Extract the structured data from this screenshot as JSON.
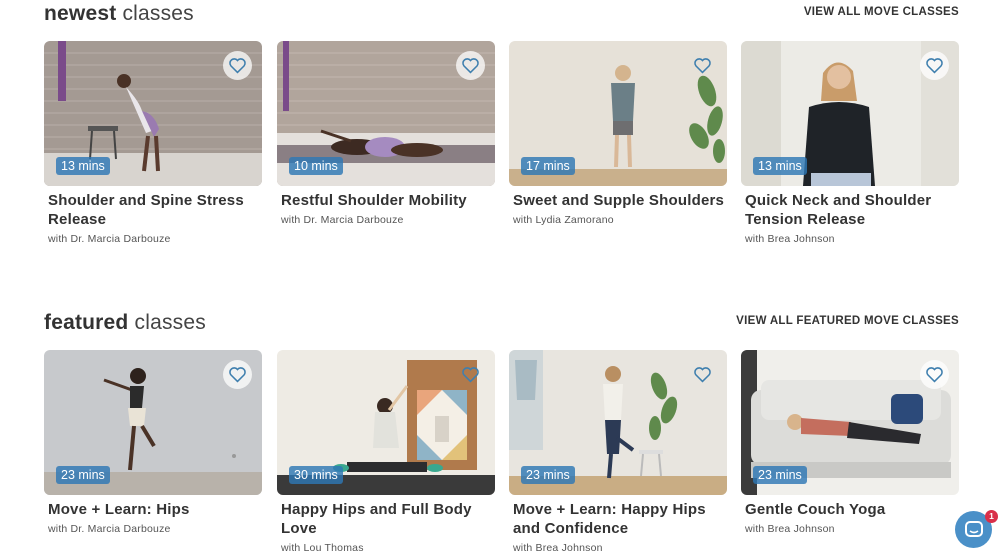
{
  "sections": {
    "newest": {
      "title_bold": "newest",
      "title_rest": "classes",
      "view_all": "VIEW ALL MOVE CLASSES",
      "cards": [
        {
          "duration": "13 mins",
          "title": "Shoulder and Spine Stress Release",
          "with": "with",
          "author": "Dr. Marcia Darbouze"
        },
        {
          "duration": "10 mins",
          "title": "Restful Shoulder Mobility",
          "with": "with",
          "author": "Dr. Marcia Darbouze"
        },
        {
          "duration": "17 mins",
          "title": "Sweet and Supple Shoulders",
          "with": "with",
          "author": "Lydia Zamorano"
        },
        {
          "duration": "13 mins",
          "title": "Quick Neck and Shoulder Tension Release",
          "with": "with",
          "author": "Brea Johnson"
        }
      ]
    },
    "featured": {
      "title_bold": "featured",
      "title_rest": "classes",
      "view_all": "VIEW ALL FEATURED MOVE CLASSES",
      "cards": [
        {
          "duration": "23 mins",
          "title": "Move + Learn: Hips",
          "with": "with",
          "author": "Dr. Marcia Darbouze"
        },
        {
          "duration": "30 mins",
          "title": "Happy Hips and Full Body Love",
          "with": "with",
          "author": "Lou Thomas"
        },
        {
          "duration": "23 mins",
          "title": "Move + Learn: Happy Hips and Confidence",
          "with": "with",
          "author": "Brea Johnson"
        },
        {
          "duration": "23 mins",
          "title": "Gentle Couch Yoga",
          "with": "with",
          "author": "Brea Johnson"
        }
      ]
    }
  },
  "chat": {
    "badge_count": "1",
    "icon": "chat-icon"
  },
  "colors": {
    "accent": "#4a90c8",
    "duration_badge": "#2e78b4",
    "badge_red": "#d9304a"
  }
}
